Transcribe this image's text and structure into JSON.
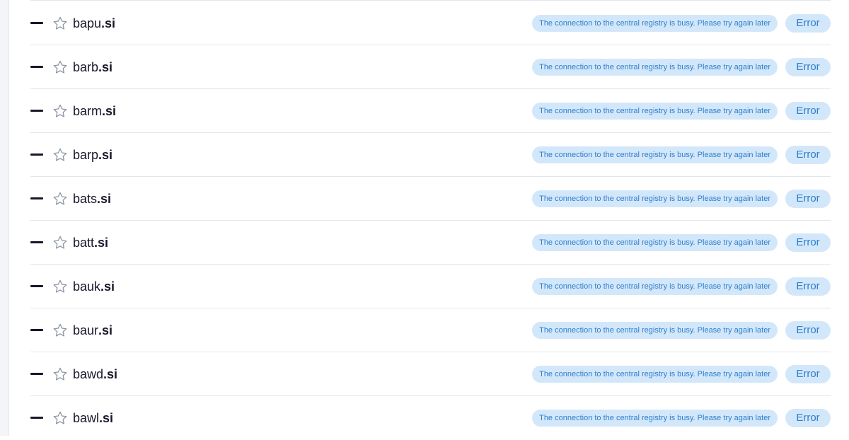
{
  "rows": [
    {
      "name": "bapu",
      "tld": ".si",
      "message": "The connection to the central registry is busy. Please try again later",
      "status": "Error"
    },
    {
      "name": "barb",
      "tld": ".si",
      "message": "The connection to the central registry is busy. Please try again later",
      "status": "Error"
    },
    {
      "name": "barm",
      "tld": ".si",
      "message": "The connection to the central registry is busy. Please try again later",
      "status": "Error"
    },
    {
      "name": "barp",
      "tld": ".si",
      "message": "The connection to the central registry is busy. Please try again later",
      "status": "Error"
    },
    {
      "name": "bats",
      "tld": ".si",
      "message": "The connection to the central registry is busy. Please try again later",
      "status": "Error"
    },
    {
      "name": "batt",
      "tld": ".si",
      "message": "The connection to the central registry is busy. Please try again later",
      "status": "Error"
    },
    {
      "name": "bauk",
      "tld": ".si",
      "message": "The connection to the central registry is busy. Please try again later",
      "status": "Error"
    },
    {
      "name": "baur",
      "tld": ".si",
      "message": "The connection to the central registry is busy. Please try again later",
      "status": "Error"
    },
    {
      "name": "bawd",
      "tld": ".si",
      "message": "The connection to the central registry is busy. Please try again later",
      "status": "Error"
    },
    {
      "name": "bawl",
      "tld": ".si",
      "message": "The connection to the central registry is busy. Please try again later",
      "status": "Error"
    }
  ],
  "icons": {
    "remove": "minus-icon",
    "favorite": "star-outline-icon"
  },
  "colors": {
    "accent": "#2f7fc9",
    "badge_bg": "#d3e7fb",
    "text": "#17182b",
    "divider": "#e2e6ea"
  }
}
